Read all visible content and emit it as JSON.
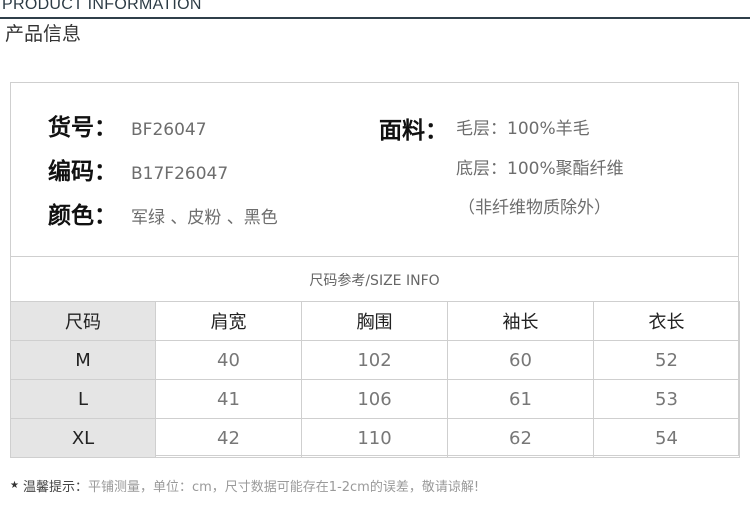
{
  "header": {
    "title_en": "PRODUCT INFORMATION",
    "title_cn": "产品信息"
  },
  "info": {
    "item_no": {
      "label": "货号：",
      "value": "BF26047"
    },
    "code": {
      "label": "编码：",
      "value": "B17F26047"
    },
    "color": {
      "label": "颜色：",
      "value": "军绿 、皮粉 、黑色"
    },
    "fabric": {
      "label": "面料：",
      "lines": [
        "毛层：100%羊毛",
        "底层：100%聚酯纤维",
        "（非纤维物质除外）"
      ]
    }
  },
  "size_table": {
    "caption": "尺码参考/SIZE INFO",
    "headers": [
      "尺码",
      "肩宽",
      "胸围",
      "袖长",
      "衣长"
    ],
    "rows": [
      [
        "M",
        "40",
        "102",
        "60",
        "52"
      ],
      [
        "L",
        "41",
        "106",
        "61",
        "53"
      ],
      [
        "XL",
        "42",
        "110",
        "62",
        "54"
      ]
    ]
  },
  "note": {
    "star": "★",
    "heading": "温馨提示：",
    "text": "平铺测量，单位：cm，尺寸数据可能存在1-2cm的误差，敬请谅解!"
  }
}
